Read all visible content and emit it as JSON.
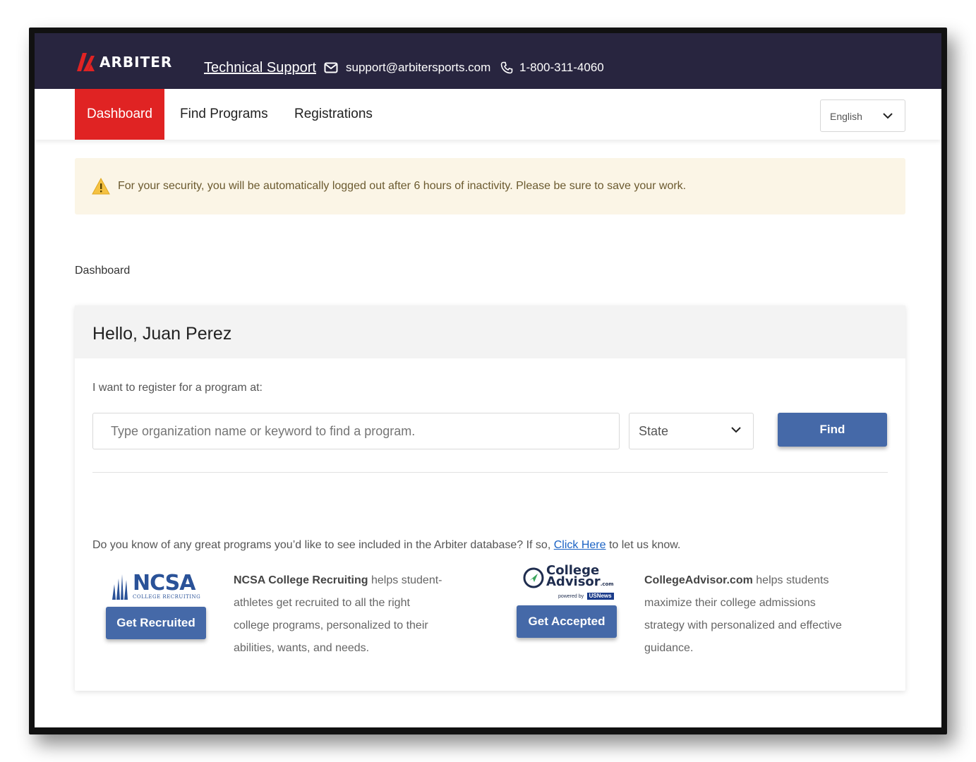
{
  "header": {
    "brand": "ARBITER",
    "support_label": "Technical Support",
    "email": "support@arbitersports.com",
    "phone": "1-800-311-4060"
  },
  "nav": {
    "tabs": [
      {
        "label": "Dashboard",
        "active": true
      },
      {
        "label": "Find Programs",
        "active": false
      },
      {
        "label": "Registrations",
        "active": false
      }
    ],
    "language": "English"
  },
  "alert": {
    "text": "For your security, you will be automatically logged out after 6 hours of inactivity. Please be sure to save your work."
  },
  "breadcrumb": "Dashboard",
  "card": {
    "greeting": "Hello, Juan Perez",
    "register_label": "I want to register for a program at:",
    "search_placeholder": "Type organization name or keyword to find a program.",
    "state_label": "State",
    "find_label": "Find",
    "suggest_before": "Do you know of any great programs you’d like to see included in the Arbiter database? If so, ",
    "suggest_link": "Click Here",
    "suggest_after": " to let us know."
  },
  "partners": {
    "ncsa": {
      "logo_word": "NCSA",
      "logo_sub": "COLLEGE RECRUITING",
      "button": "Get Recruited",
      "name": "NCSA College Recruiting",
      "desc_line1": " helps student-",
      "desc_line2": "athletes get recruited to all the right",
      "desc_line3": "college programs, personalized to their",
      "desc_line4": "abilities, wants, and needs."
    },
    "college_advisor": {
      "logo_line1": "College",
      "logo_line2": "Advisor",
      "logo_com": ".com",
      "logo_powered": "powered by",
      "logo_usnews": "USNews",
      "button": "Get Accepted",
      "name": "CollegeAdvisor.com",
      "desc_line1": " helps students",
      "desc_line2": "maximize their college admissions",
      "desc_line3": "strategy with personalized and effective",
      "desc_line4": "guidance."
    }
  },
  "colors": {
    "header_bg": "#28253f",
    "active_tab": "#e02323",
    "button_blue": "#4569a8",
    "alert_bg": "#fbf5e6",
    "link": "#1a62c4"
  },
  "icons": [
    "arbiter-logo-icon",
    "mail-icon",
    "phone-icon",
    "chevron-down-icon",
    "warning-icon",
    "ncsa-logo-icon",
    "college-advisor-logo-icon"
  ]
}
